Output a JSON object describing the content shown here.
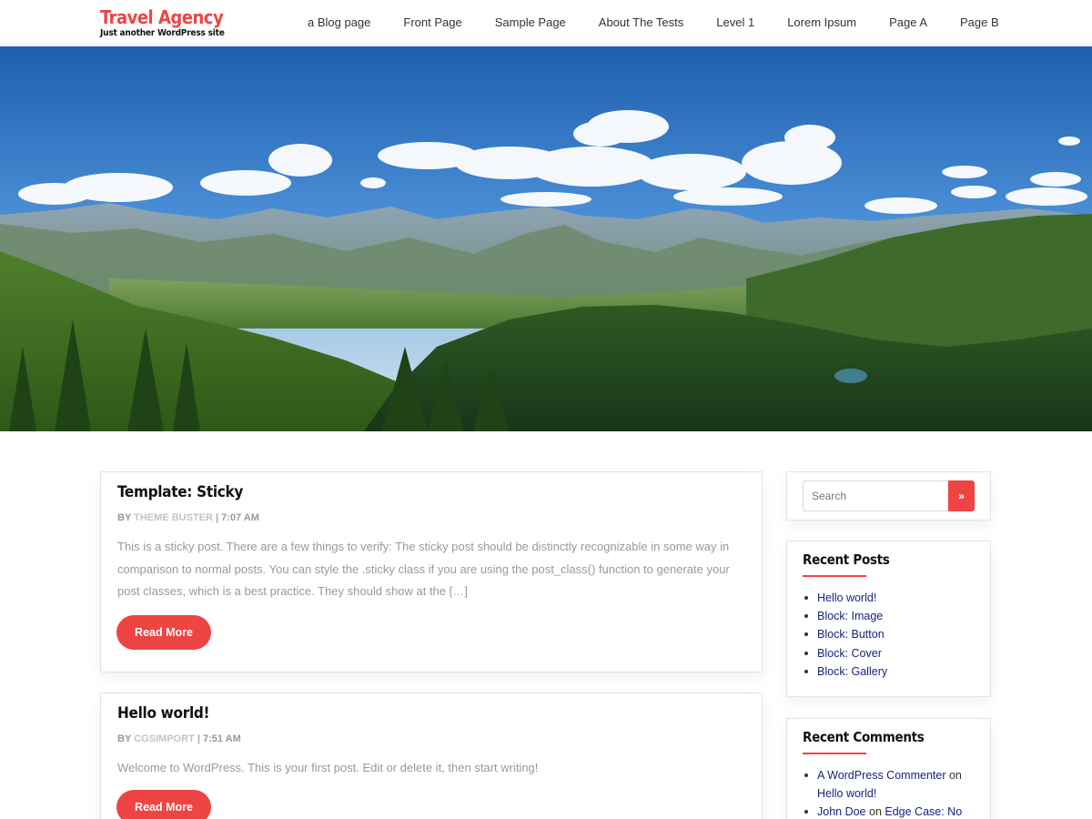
{
  "site": {
    "title": "Travel Agency",
    "tagline": "Just another WordPress site",
    "brand_color": "#ef4444"
  },
  "nav": {
    "items": [
      "a Blog page",
      "Front Page",
      "Sample Page",
      "About The Tests",
      "Level 1",
      "Lorem Ipsum",
      "Page A",
      "Page B"
    ]
  },
  "posts": [
    {
      "title": "Template: Sticky",
      "by": "BY",
      "author": "THEME BUSTER",
      "separator": "|",
      "time": "7:07 AM",
      "excerpt": "This is a sticky post. There are a few things to verify: The sticky post should be distinctly recognizable in some way in comparison to normal posts. You can style the .sticky class if you are using the post_class() function to generate your post classes, which is a best practice. They should show at the […]",
      "button": "Read More"
    },
    {
      "title": "Hello world!",
      "by": "BY",
      "author": "CGSIMPORT",
      "separator": "|",
      "time": "7:51 AM",
      "excerpt": "Welcome to WordPress. This is your first post. Edit or delete it, then start writing!",
      "button": "Read More"
    }
  ],
  "sidebar": {
    "search": {
      "placeholder": "Search",
      "button": "»"
    },
    "recent_posts": {
      "title": "Recent Posts",
      "items": [
        "Hello world!",
        "Block: Image",
        "Block: Button",
        "Block: Cover",
        "Block: Gallery"
      ]
    },
    "recent_comments": {
      "title": "Recent Comments",
      "items": [
        {
          "author": "A WordPress Commenter",
          "on": "on",
          "post": "Hello world!"
        },
        {
          "author": "John Doe",
          "on": "on",
          "post": "Edge Case: No"
        }
      ]
    }
  }
}
